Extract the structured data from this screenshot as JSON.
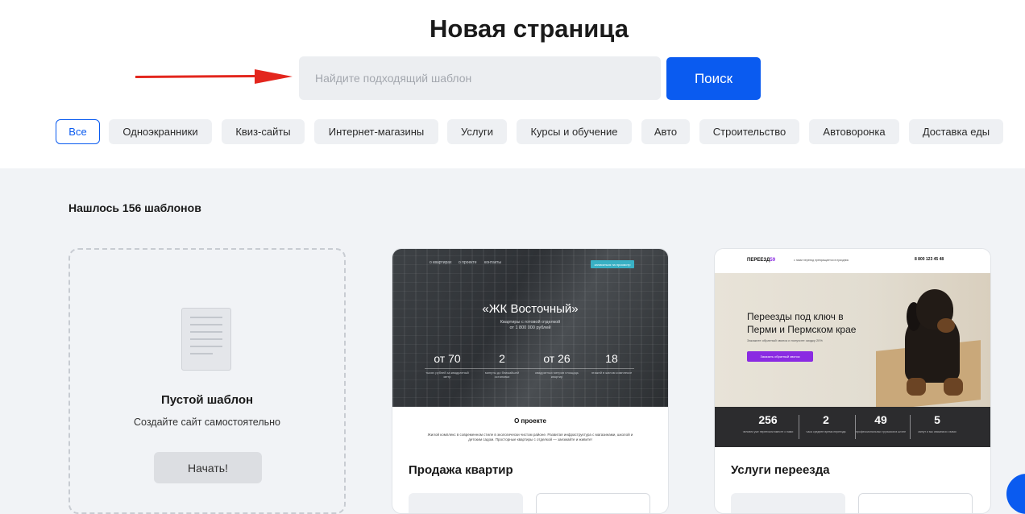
{
  "page": {
    "title": "Новая страница",
    "search_placeholder": "Найдите подходящий шаблон",
    "search_button": "Поиск",
    "found_text": "Нашлось 156 шаблонов"
  },
  "accent_color": "#0a5bf0",
  "filters": [
    "Все",
    "Одноэкранники",
    "Квиз-сайты",
    "Интернет-магазины",
    "Услуги",
    "Курсы и обучение",
    "Авто",
    "Строительство",
    "Автоворонка",
    "Доставка еды"
  ],
  "active_filter": "Все",
  "blank_card": {
    "title": "Пустой шаблон",
    "subtitle": "Создайте сайт самостоятельно",
    "button": "Начать!",
    "icon": "document-icon"
  },
  "cards": [
    {
      "name": "Продажа квартир",
      "preview": {
        "nav": [
          "о квартирах",
          "о проекте",
          "контакты"
        ],
        "cta": "записаться на просмотр",
        "headline": "«ЖК Восточный»",
        "subline_1": "Квартиры с готовой отделкой",
        "subline_2": "от 1 800 000 рублей",
        "stats": [
          {
            "value": "от 70",
            "label": "тысяч рублей за квадратный метр"
          },
          {
            "value": "2",
            "label": "минуты до ближайшей остановки"
          },
          {
            "value": "от 26",
            "label": "квадратных метров площадь квартир"
          },
          {
            "value": "18",
            "label": "этажей в жилом комплексе"
          }
        ],
        "about_title": "О проекте",
        "about_text": "Жилой комплекс в современном стиле в экологически чистом районе. Развитая инфраструктура с магазинами, школой и детским садом. Просторные квартиры с отделкой — заезжайте и живите!"
      }
    },
    {
      "name": "Услуги переезда",
      "preview": {
        "logo": "ПЕРЕЕЗД",
        "logo_num": "59",
        "tagline": "с нами переезд превращается в праздник",
        "phone": "8 800 123 45 48",
        "headline_1": "Переезды под ключ в",
        "headline_2": "Перми и Пермском крае",
        "text": "Закажите обратный звонок и получите скидку 20%",
        "button": "Заказать обратный звонок",
        "stats": [
          {
            "value": "256",
            "label": "человек уже переехали вместе с нами"
          },
          {
            "value": "2",
            "label": "часа среднее время переезда"
          },
          {
            "value": "49",
            "label": "профессиональных грузчиков в штате"
          },
          {
            "value": "5",
            "label": "минут и мы свяжемся с вами"
          }
        ]
      }
    }
  ]
}
